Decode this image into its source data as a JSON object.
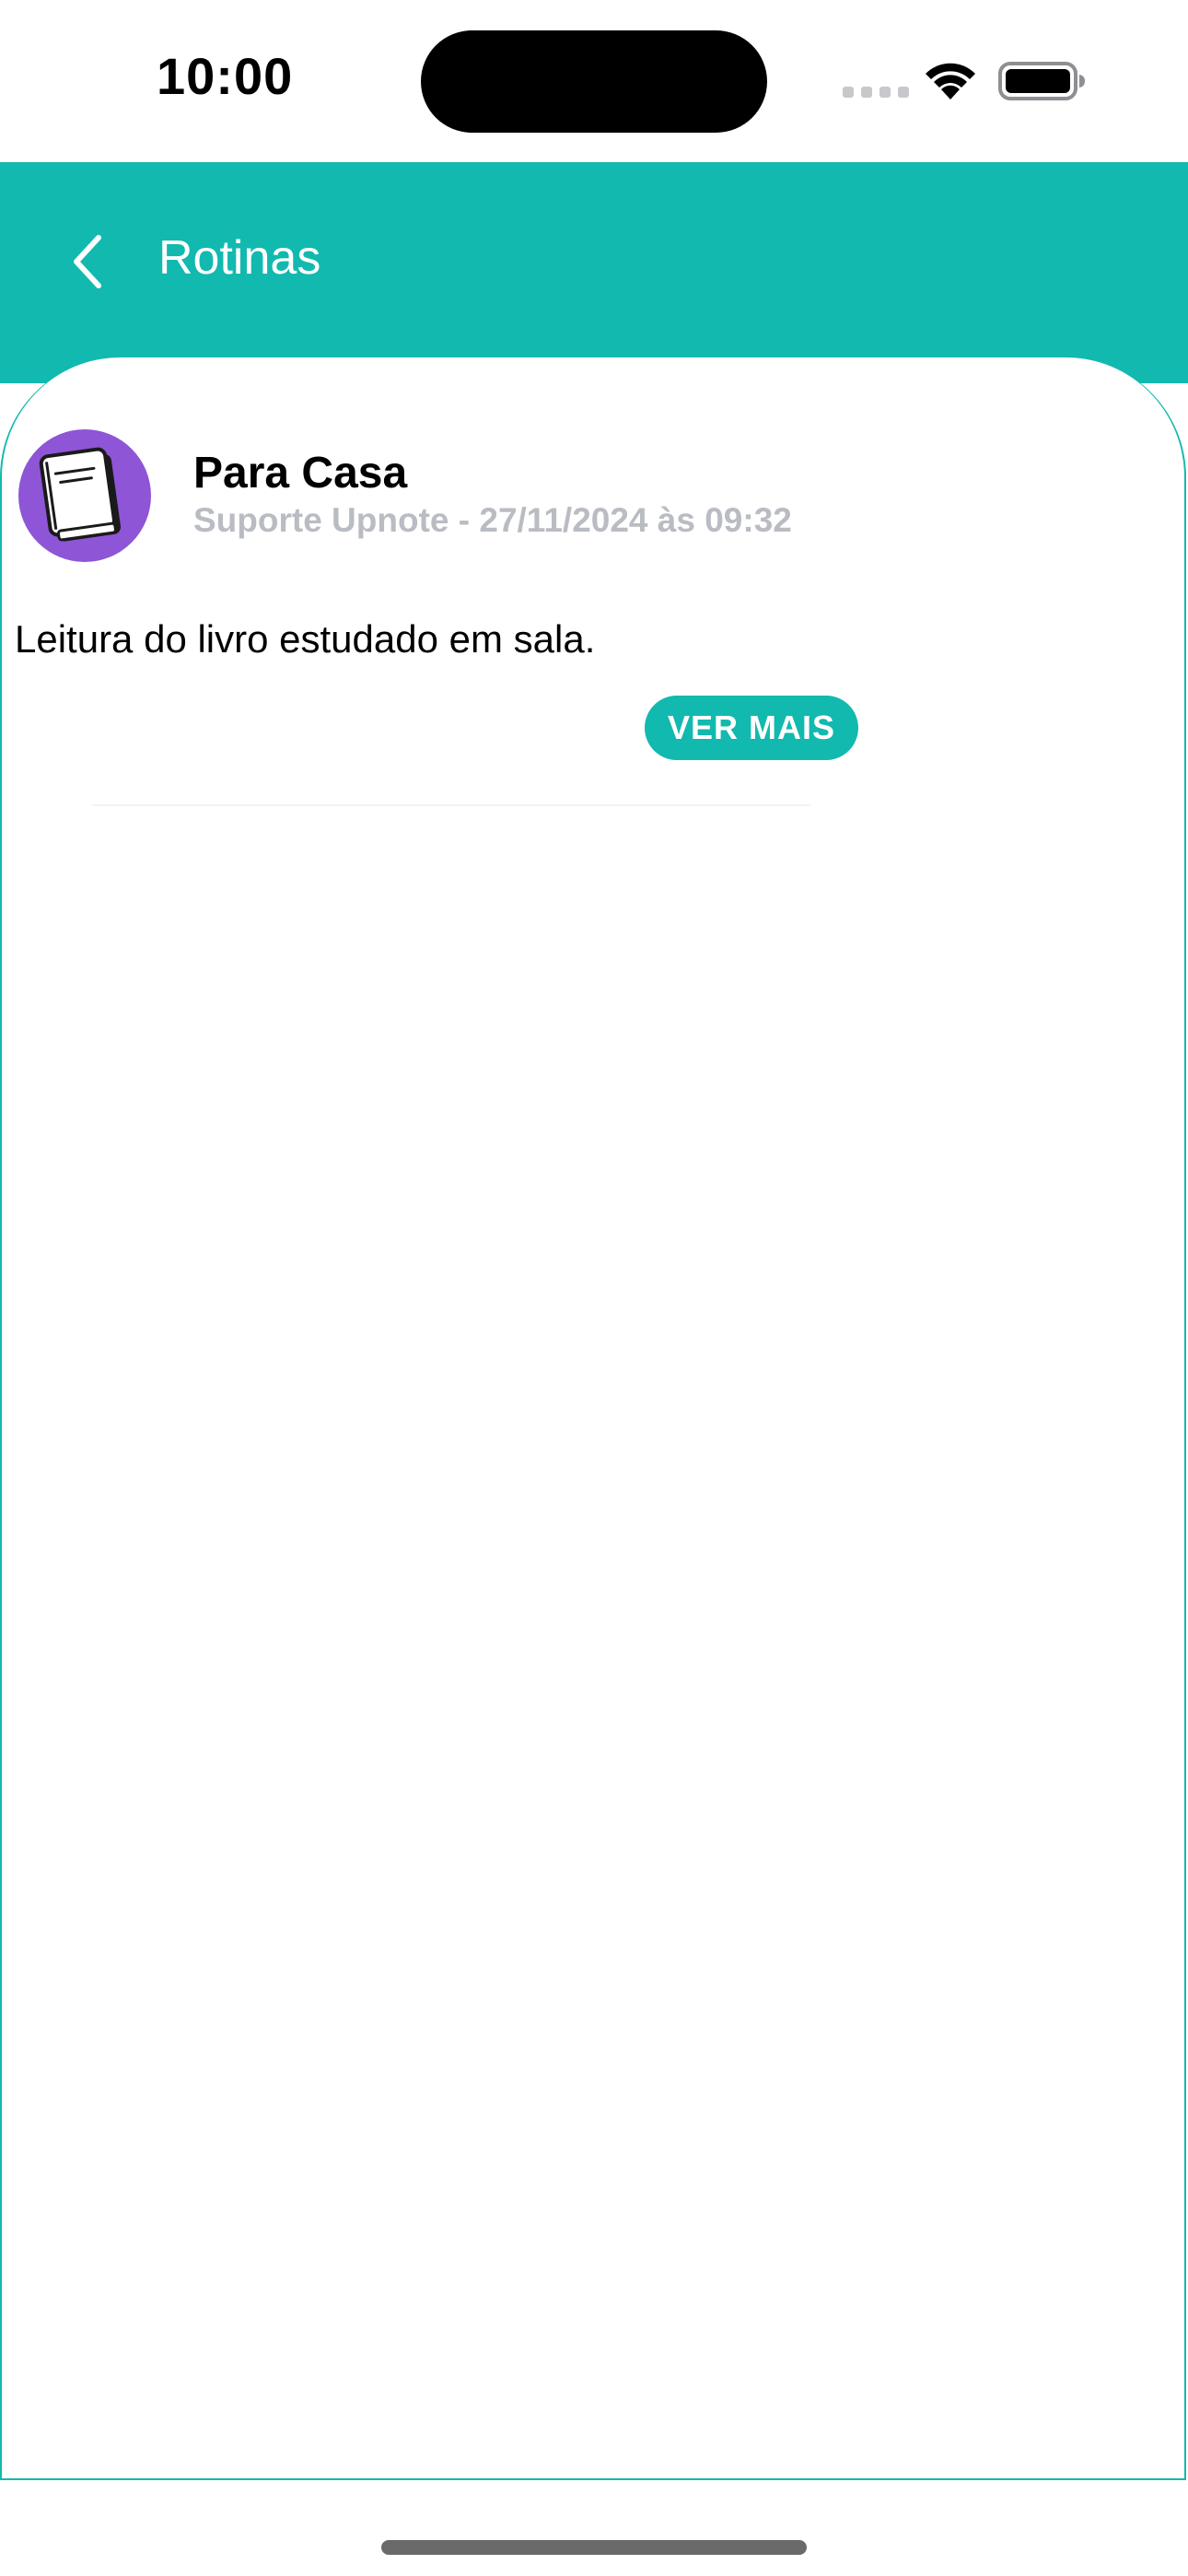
{
  "status_bar": {
    "time": "10:00"
  },
  "header": {
    "title": "Rotinas",
    "back_icon": "chevron-left-icon"
  },
  "item": {
    "icon": "book-icon",
    "title": "Para Casa",
    "meta": "Suporte Upnote - 27/11/2024 às 09:32",
    "description": "Leitura do livro estudado em sala.",
    "button_label": "VER MAIS"
  },
  "colors": {
    "accent": "#12b9af",
    "avatar_bg": "#8e55d6",
    "meta_text": "#b9bcc2"
  }
}
